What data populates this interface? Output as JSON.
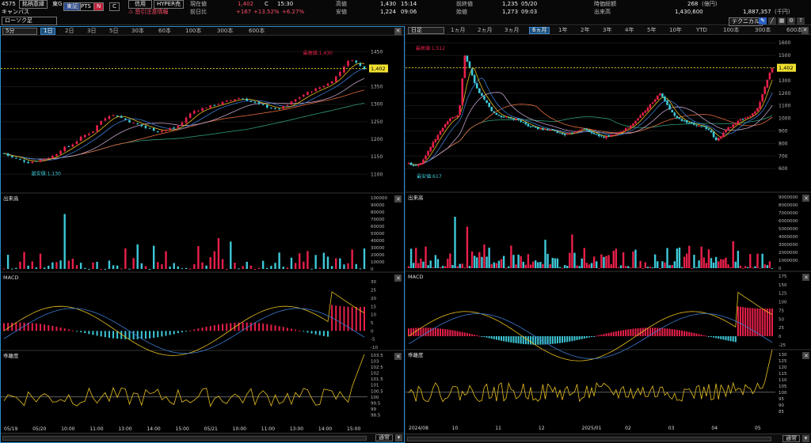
{
  "header": {
    "code": "4575",
    "tag_company": "銘柄意縁",
    "market": "東G",
    "name": "キャンバス",
    "chart_style": "ローソク足",
    "btn_tosho": "東証",
    "btn_pts": "PTS",
    "btn_n": "N",
    "btn_c": "C",
    "btn_shinyo": "信用",
    "btn_hyper": "HYPER売",
    "warning": "⚠ 怒引注意情報",
    "lbl_price": "現在値",
    "price": "1,402",
    "price_mark": "C",
    "price_time": "15:30",
    "lbl_change": "前日比",
    "change": "+167",
    "change_pct1": "+13.52%",
    "change_pct2": "+6.27%",
    "lbl_high": "高値",
    "high": "1,430",
    "high_time": "15:14",
    "lbl_low": "安値",
    "low": "1,224",
    "low_time": "09:06",
    "lbl_prevclose": "前終値",
    "prevclose": "1,235",
    "prevclose_date": "05/20",
    "lbl_open": "始値",
    "open": "1,273",
    "open_time": "09:03",
    "lbl_mcap": "時価総額",
    "mcap": "268",
    "mcap_unit": "(億円)",
    "lbl_volume": "出来高",
    "volume": "1,430,600",
    "turnover": "1,887,357",
    "turnover_unit": "(千円)",
    "btn_technical": "テクニカル"
  },
  "left": {
    "interval": "5分",
    "tabs": [
      "1日",
      "2日",
      "3日",
      "5日",
      "30本",
      "60本",
      "100本",
      "300本",
      "600本"
    ],
    "active_tab": 0,
    "dates": [
      "05/19",
      "05/20",
      "10:00",
      "11:00",
      "13:00",
      "14:00",
      "15:00",
      "05/21",
      "10:00",
      "11:00",
      "13:00",
      "14:00",
      "15:00"
    ],
    "footer_select": "通常"
  },
  "right": {
    "interval": "日足",
    "tabs": [
      "1ヵ月",
      "2ヵ月",
      "3ヵ月",
      "6ヵ月",
      "1年",
      "2年",
      "3年",
      "4年",
      "5年",
      "10年",
      "YTD",
      "100本",
      "300本",
      "600本"
    ],
    "active_tab": 3,
    "dates": [
      "2024/08",
      "10",
      "11",
      "12",
      "2025/01",
      "02",
      "03",
      "04",
      "05"
    ],
    "footer_select": "通常"
  },
  "chart_data": [
    {
      "type": "candlestick",
      "title": "5分足",
      "ylim": [
        1060,
        1480
      ],
      "yticks": [
        1100,
        1150,
        1200,
        1250,
        1300,
        1350,
        1400,
        1450
      ],
      "last_price": "1,402",
      "high_label": "最高値:1,430",
      "low_label": "最安値:1,130",
      "x": [
        "05/19",
        "05/20",
        "10:00",
        "11:00",
        "13:00",
        "14:00",
        "15:00",
        "05/21",
        "10:00",
        "11:00",
        "13:00",
        "14:00",
        "15:00"
      ],
      "close_path": [
        1160,
        1150,
        1145,
        1140,
        1133,
        1137,
        1140,
        1145,
        1150,
        1160,
        1175,
        1180,
        1190,
        1205,
        1215,
        1222,
        1245,
        1260,
        1270,
        1268,
        1260,
        1252,
        1245,
        1240,
        1232,
        1228,
        1222,
        1225,
        1230,
        1232,
        1245,
        1265,
        1280,
        1285,
        1290,
        1295,
        1300,
        1305,
        1310,
        1315,
        1318,
        1312,
        1306,
        1300,
        1295,
        1290,
        1285,
        1290,
        1298,
        1310,
        1320,
        1330,
        1338,
        1345,
        1352,
        1360,
        1375,
        1395,
        1420,
        1428,
        1412,
        1402
      ],
      "subplots": [
        {
          "name": "出来高",
          "ylim": [
            0,
            100000
          ],
          "yticks": [
            0,
            10000,
            20000,
            30000,
            40000,
            50000,
            60000,
            70000,
            80000,
            90000,
            100000
          ]
        },
        {
          "name": "MACD",
          "ylim": [
            -10,
            33
          ],
          "yticks": [
            -10,
            -5,
            0,
            5,
            10,
            15,
            20,
            25,
            30
          ]
        },
        {
          "name": "乖離度",
          "ylim": [
            98,
            103.5
          ],
          "yticks": [
            98.5,
            99.0,
            99.5,
            100.0,
            100.5,
            101.0,
            101.5,
            102.0,
            102.5,
            103.0,
            103.5
          ]
        }
      ]
    },
    {
      "type": "candlestick",
      "title": "日足",
      "ylim": [
        450,
        1620
      ],
      "yticks": [
        600,
        700,
        800,
        900,
        1000,
        1100,
        1200,
        1300,
        1400,
        1500,
        1600
      ],
      "last_price": "1,402",
      "high_label": "最高値:1,512",
      "low_label": "最安値:617",
      "x": [
        "2024/08",
        "10",
        "11",
        "12",
        "2025/01",
        "02",
        "03",
        "04",
        "05"
      ],
      "close_path": [
        640,
        625,
        640,
        700,
        780,
        850,
        920,
        980,
        1010,
        1020,
        1510,
        1380,
        1250,
        1180,
        1120,
        1050,
        1020,
        1010,
        1000,
        990,
        980,
        950,
        930,
        920,
        910,
        905,
        900,
        880,
        870,
        880,
        900,
        920,
        900,
        880,
        860,
        850,
        860,
        880,
        900,
        920,
        950,
        1000,
        1050,
        1100,
        1150,
        1200,
        1120,
        1050,
        1000,
        980,
        960,
        950,
        940,
        930,
        890,
        820,
        870,
        920,
        950,
        980,
        1000,
        1020,
        1050,
        1150,
        1300,
        1402
      ],
      "subplots": [
        {
          "name": "出来高",
          "ylim": [
            0,
            9000000
          ],
          "yticks": [
            0,
            1000000,
            2000000,
            3000000,
            4000000,
            5000000,
            6000000,
            7000000,
            8000000,
            9000000
          ]
        },
        {
          "name": "MACD",
          "ylim": [
            -30,
            175
          ],
          "yticks": [
            -25,
            0,
            25,
            50,
            75,
            100,
            125,
            150,
            175
          ]
        },
        {
          "name": "乖離度",
          "ylim": [
            78,
            130
          ],
          "yticks": [
            85,
            90,
            95,
            100,
            105,
            110,
            115,
            120,
            125,
            130
          ]
        }
      ]
    }
  ]
}
